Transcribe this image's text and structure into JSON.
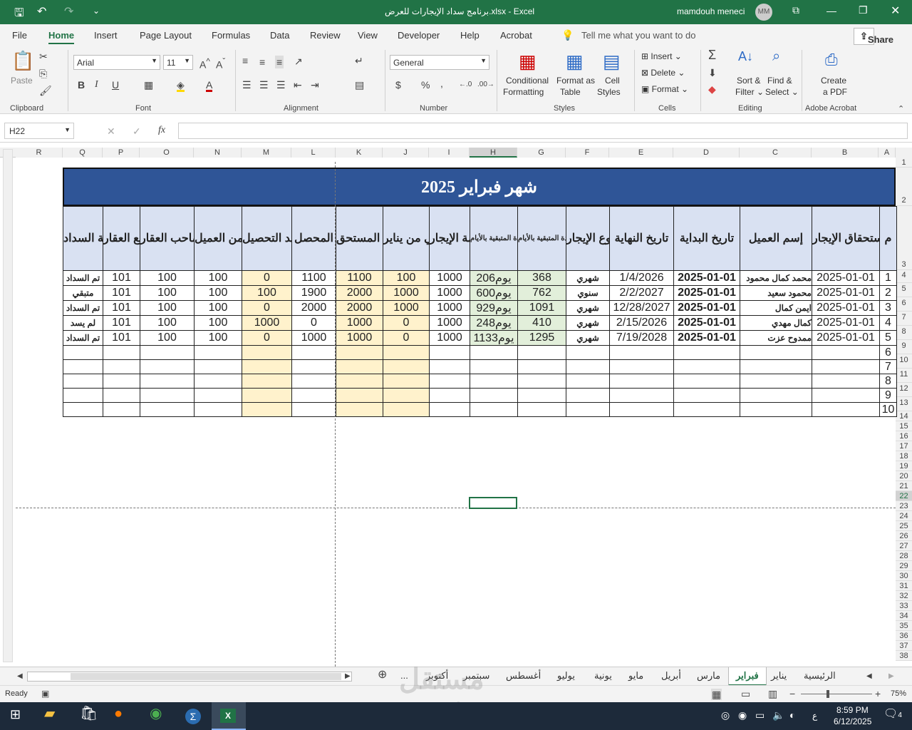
{
  "title_bar": {
    "file_title": "برنامج سداد الإيجارات للعرض.xlsx  -  Excel",
    "user": "mamdouh meneci",
    "avatar": "MM"
  },
  "menu": [
    "File",
    "Home",
    "Insert",
    "Page Layout",
    "Formulas",
    "Data",
    "Review",
    "View",
    "Developer",
    "Help",
    "Acrobat"
  ],
  "tell_me": "Tell me what you want to do",
  "share": "Share",
  "ribbon": {
    "paste": "Paste",
    "font_name": "Arial",
    "font_size": "11",
    "number_format": "General",
    "conditional": "Conditional",
    "formatting": "Formatting",
    "format_as": "Format as",
    "table": "Table",
    "cell": "Cell",
    "styles": "Styles",
    "insert": "Insert",
    "delete": "Delete",
    "format": "Format",
    "sort": "Sort &",
    "filter": "Filter",
    "find": "Find &",
    "select": "Select",
    "create": "Create",
    "apdf": "a PDF",
    "groups": [
      "Clipboard",
      "Font",
      "Alignment",
      "Number",
      "Styles",
      "Cells",
      "Editing",
      "Adobe Acrobat"
    ]
  },
  "name_box": "H22",
  "formula": "",
  "columns": [
    "R",
    "Q",
    "P",
    "O",
    "N",
    "M",
    "L",
    "K",
    "J",
    "I",
    "H",
    "G",
    "F",
    "E",
    "D",
    "C",
    "B",
    "A"
  ],
  "rows": [
    "1",
    "2",
    "3",
    "4",
    "5",
    "6",
    "7",
    "8",
    "9",
    "10",
    "11",
    "12",
    "13",
    "14",
    "15",
    "16",
    "17",
    "18",
    "19",
    "20",
    "21",
    "22",
    "23",
    "24",
    "25",
    "26",
    "27",
    "28",
    "29",
    "30",
    "31",
    "32",
    "33",
    "34",
    "35",
    "36",
    "37",
    "38"
  ],
  "sheet": {
    "title": "شهر فبراير 2025",
    "headers": [
      "حالة السداد",
      "موقع العقار",
      "عمولة المكتب من صاحب العقار",
      "عمولة المكتب من العميل",
      "المتبقي بعد التحصيل",
      "المحصل",
      "الإجمالي المستحق",
      "المتبقي من يناير",
      "قيمة الإيجار",
      "المدة المتبقية بالأيام",
      "المدة المتبقية بالأيام",
      "نوع الإيجار",
      "تاريخ النهاية",
      "تاريخ البداية",
      "إسم العميل",
      "تاريخ إستحقاق الإيجار",
      "م"
    ],
    "rows": [
      [
        "تم السداد",
        "101",
        "100",
        "100",
        "0",
        "1100",
        "1100",
        "100",
        "1000",
        "206يوم",
        "368",
        "شهري",
        "1/4/2026",
        "2025-01-01",
        "محمد كمال محمود",
        "2025-01-01",
        "1"
      ],
      [
        "متبقي",
        "101",
        "100",
        "100",
        "100",
        "1900",
        "2000",
        "1000",
        "1000",
        "600يوم",
        "762",
        "سنوي",
        "2/2/2027",
        "2025-01-01",
        "محمود سعيد",
        "2025-01-01",
        "2"
      ],
      [
        "تم السداد",
        "101",
        "100",
        "100",
        "0",
        "2000",
        "2000",
        "1000",
        "1000",
        "929يوم",
        "1091",
        "شهري",
        "12/28/2027",
        "2025-01-01",
        "ايمن كمال",
        "2025-01-01",
        "3"
      ],
      [
        "لم يسد",
        "101",
        "100",
        "100",
        "1000",
        "0",
        "1000",
        "0",
        "1000",
        "248يوم",
        "410",
        "شهري",
        "2/15/2026",
        "2025-01-01",
        "كمال مهدي",
        "2025-01-01",
        "4"
      ],
      [
        "تم السداد",
        "101",
        "100",
        "100",
        "0",
        "1000",
        "1000",
        "0",
        "1000",
        "1133يوم",
        "1295",
        "شهري",
        "7/19/2028",
        "2025-01-01",
        "ممدوح عزت",
        "2025-01-01",
        "5"
      ],
      [
        "",
        "",
        "",
        "",
        "",
        "",
        "",
        "",
        "",
        "",
        "",
        "",
        "",
        "",
        "",
        "",
        "6"
      ],
      [
        "",
        "",
        "",
        "",
        "",
        "",
        "",
        "",
        "",
        "",
        "",
        "",
        "",
        "",
        "",
        "",
        "7"
      ],
      [
        "",
        "",
        "",
        "",
        "",
        "",
        "",
        "",
        "",
        "",
        "",
        "",
        "",
        "",
        "",
        "",
        "8"
      ],
      [
        "",
        "",
        "",
        "",
        "",
        "",
        "",
        "",
        "",
        "",
        "",
        "",
        "",
        "",
        "",
        "",
        "9"
      ],
      [
        "",
        "",
        "",
        "",
        "",
        "",
        "",
        "",
        "",
        "",
        "",
        "",
        "",
        "",
        "",
        "",
        "10"
      ]
    ]
  },
  "tabs": [
    "...",
    "أكتوبر",
    "سبتمبر",
    "أغسطس",
    "يوليو",
    "يونية",
    "مايو",
    "أبريل",
    "مارس",
    "فبراير",
    "يناير",
    "الرئيسية"
  ],
  "status": {
    "ready": "Ready",
    "zoom": "75%"
  },
  "watermark": {
    "brand": "مستقل",
    "url": "mostaql.com"
  },
  "taskbar": {
    "time": "8:59 PM",
    "date": "6/12/2025",
    "lang": "ع",
    "notif": "4"
  }
}
